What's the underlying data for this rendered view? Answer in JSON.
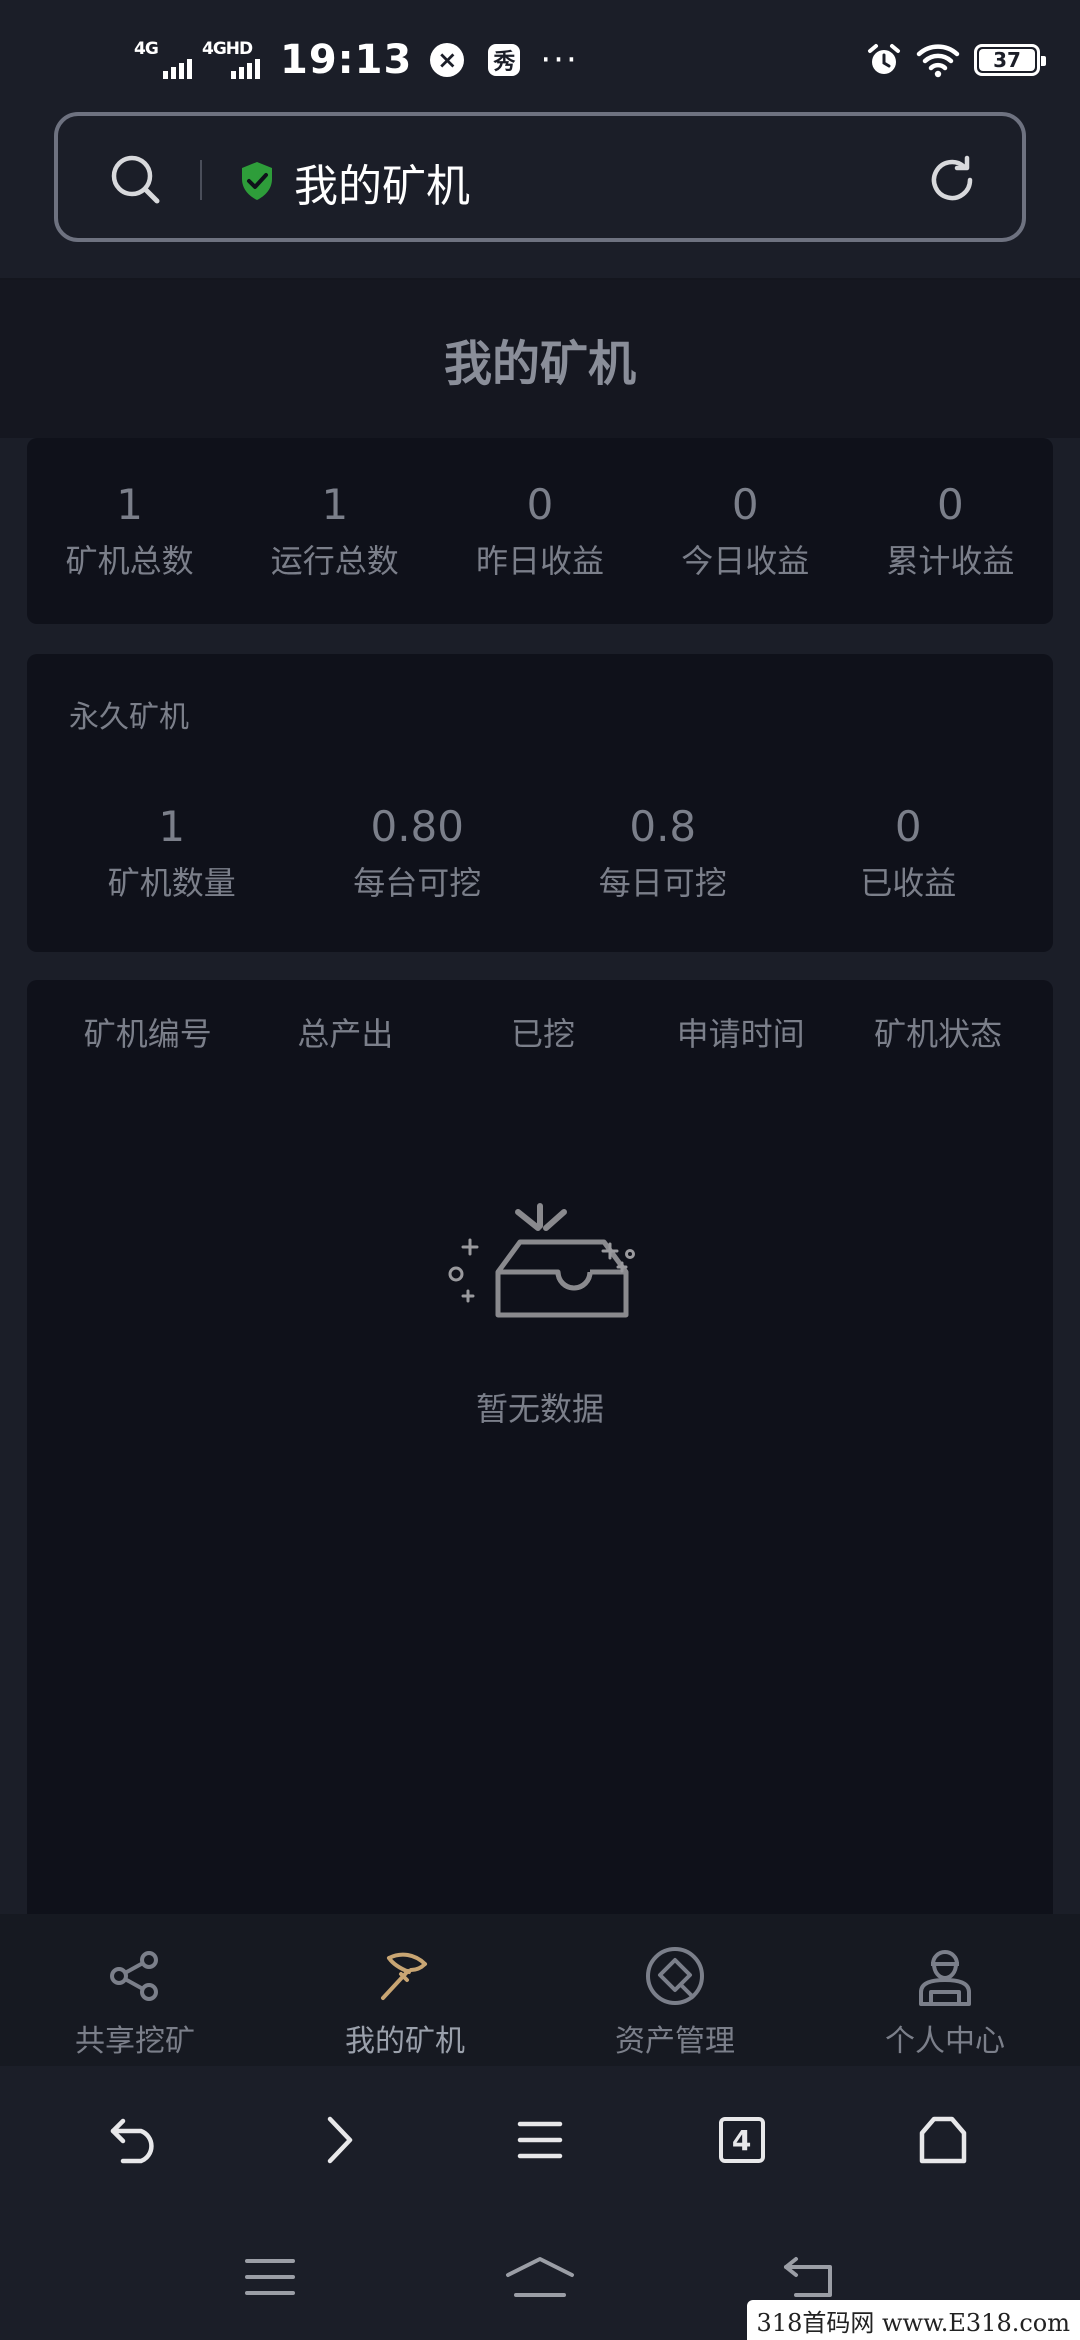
{
  "status_bar": {
    "sim1": "4G",
    "sim2": "4GHD",
    "time": "19:13",
    "x_badge": "×",
    "xiu_badge": "秀",
    "more": "···",
    "battery": "37"
  },
  "address_bar": {
    "title": "我的矿机",
    "icons": [
      "search-icon",
      "shield-check-icon",
      "refresh-icon"
    ],
    "secure_color": "#2e9d3a"
  },
  "page": {
    "title": "我的矿机"
  },
  "summary": {
    "items": [
      {
        "value": "1",
        "label": "矿机总数"
      },
      {
        "value": "1",
        "label": "运行总数"
      },
      {
        "value": "0",
        "label": "昨日收益"
      },
      {
        "value": "0",
        "label": "今日收益"
      },
      {
        "value": "0",
        "label": "累计收益"
      }
    ]
  },
  "permanent": {
    "title": "永久矿机",
    "items": [
      {
        "value": "1",
        "label": "矿机数量"
      },
      {
        "value": "0.80",
        "label": "每台可挖"
      },
      {
        "value": "0.8",
        "label": "每日可挖"
      },
      {
        "value": "0",
        "label": "已收益"
      }
    ]
  },
  "table": {
    "columns": [
      "矿机编号",
      "总产出",
      "已挖",
      "申请时间",
      "矿机状态"
    ],
    "empty_text": "暂无数据"
  },
  "tabbar": {
    "items": [
      {
        "label": "共享挖矿",
        "icon": "share-icon"
      },
      {
        "label": "我的矿机",
        "icon": "pickaxe-icon",
        "active": true
      },
      {
        "label": "资产管理",
        "icon": "asset-icon"
      },
      {
        "label": "个人中心",
        "icon": "user-icon"
      }
    ],
    "active_color": "#c8a573"
  },
  "browser_bar": {
    "tab_count": "4",
    "icons": [
      "back-icon",
      "forward-icon",
      "menu-icon",
      "tabs-icon",
      "home-icon"
    ]
  },
  "system_nav": {
    "icons": [
      "recents-icon",
      "home-icon",
      "back-icon"
    ]
  },
  "watermark": "318首码网 www.E318.com"
}
